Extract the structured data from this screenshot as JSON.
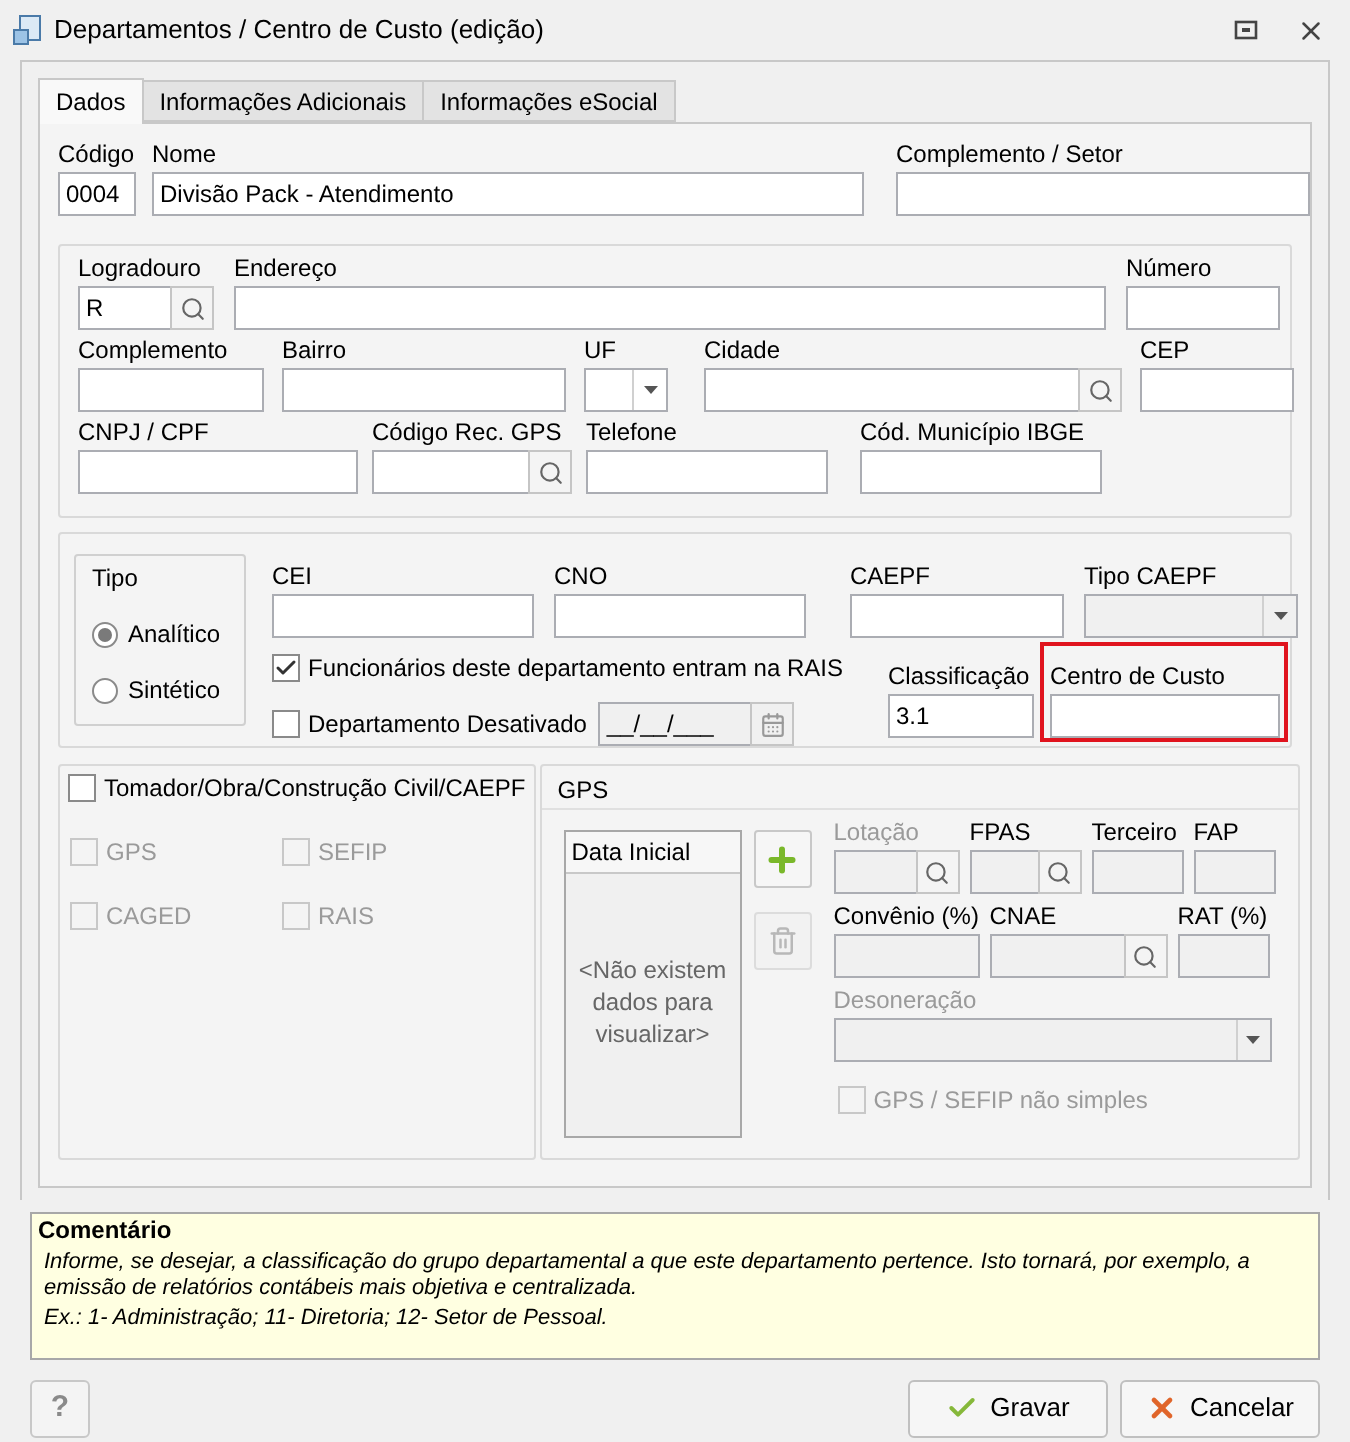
{
  "window": {
    "title": "Departamentos / Centro de Custo (edição)"
  },
  "tabs": [
    {
      "label": "Dados",
      "selected": true
    },
    {
      "label": "Informações Adicionais",
      "selected": false
    },
    {
      "label": "Informações eSocial",
      "selected": false
    }
  ],
  "identification": {
    "codigo": {
      "label": "Código",
      "value": "0004"
    },
    "nome": {
      "label": "Nome",
      "value": "Divisão Pack - Atendimento"
    },
    "complemento_setor": {
      "label": "Complemento / Setor"
    }
  },
  "address": {
    "logradouro": {
      "label": "Logradouro",
      "value": "R"
    },
    "endereco": {
      "label": "Endereço"
    },
    "numero": {
      "label": "Número"
    },
    "complemento": {
      "label": "Complemento"
    },
    "bairro": {
      "label": "Bairro"
    },
    "uf": {
      "label": "UF"
    },
    "cidade": {
      "label": "Cidade"
    },
    "cep": {
      "label": "CEP"
    },
    "cnpj_cpf": {
      "label": "CNPJ / CPF"
    },
    "codigo_rec_gps": {
      "label": "Código Rec. GPS"
    },
    "telefone": {
      "label": "Telefone"
    },
    "cod_municipio_ibge": {
      "label": "Cód. Município IBGE"
    }
  },
  "tipo": {
    "title": "Tipo",
    "options": [
      {
        "label": "Analítico",
        "selected": true
      },
      {
        "label": "Sintético",
        "selected": false
      }
    ]
  },
  "registration": {
    "cei": {
      "label": "CEI"
    },
    "cno": {
      "label": "CNO"
    },
    "caepf": {
      "label": "CAEPF"
    },
    "tipo_caepf": {
      "label": "Tipo CAEPF"
    },
    "funcionarios_rais": {
      "label": "Funcionários deste departamento entram na RAIS",
      "checked": true
    },
    "desativado": {
      "label": "Departamento Desativado",
      "checked": false
    },
    "data_desativacao": {
      "value": "__/__/___",
      "disabled": true
    },
    "classificacao": {
      "label": "Classificação",
      "value": "3.1"
    },
    "centro_de_custo": {
      "label": "Centro de Custo",
      "highlighted": true
    }
  },
  "tomador": {
    "label": "Tomador/Obra/Construção Civil/CAEPF",
    "checked": false,
    "options": [
      {
        "label": "GPS",
        "checked": false,
        "disabled": true
      },
      {
        "label": "SEFIP",
        "checked": false,
        "disabled": true
      },
      {
        "label": "CAGED",
        "checked": false,
        "disabled": true
      },
      {
        "label": "RAIS",
        "checked": false,
        "disabled": true
      }
    ]
  },
  "gps": {
    "title": "GPS",
    "list": {
      "header": "Data Inicial",
      "empty": "<Não existem dados para visualizar>"
    },
    "lotacao": {
      "label": "Lotação",
      "disabled": true
    },
    "fpas": {
      "label": "FPAS",
      "disabled": false
    },
    "terceiro": {
      "label": "Terceiro",
      "disabled": false
    },
    "fap": {
      "label": "FAP",
      "disabled": false
    },
    "convenio": {
      "label": "Convênio (%)",
      "disabled": false
    },
    "cnae": {
      "label": "CNAE",
      "disabled": false
    },
    "rat": {
      "label": "RAT (%)",
      "disabled": false
    },
    "desoneracao": {
      "label": "Desoneração",
      "disabled": true
    },
    "gps_sefip": {
      "label": "GPS / SEFIP não simples",
      "checked": false,
      "disabled": true
    }
  },
  "comment": {
    "title": "Comentário",
    "lines": [
      "Informe, se desejar, a classificação do grupo departamental a que este departamento pertence. Isto tornará, por exemplo, a emissão de relatórios contábeis mais objetiva e centralizada.",
      "Ex.: 1- Administração; 11- Diretoria; 12- Setor de Pessoal."
    ]
  },
  "buttons": {
    "help": "?",
    "save": "Gravar",
    "cancel": "Cancelar"
  }
}
